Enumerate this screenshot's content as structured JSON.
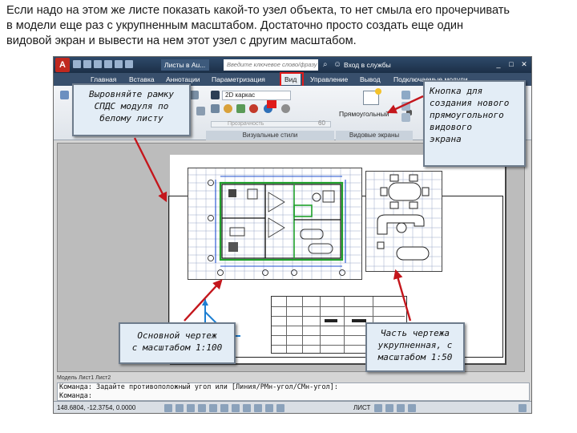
{
  "slide": {
    "lines": [
      "Если надо на этом же листе показать какой-то узел объекта, то нет смыла его прочерчивать",
      "в модели еще раз с укрупненным масштабом. Достаточно просто создать еще один",
      "видовой экран и вывести на нем этот узел с другим масштабом."
    ]
  },
  "titlebar": {
    "logo": "A",
    "doc_tab": "Листы в Au...",
    "search_placeholder": "Введите ключевое слово/фразу",
    "signin": "Вход в службы",
    "buttons": [
      "_",
      "□",
      "✕"
    ]
  },
  "ribbon": {
    "tabs": [
      "Главная",
      "Вставка",
      "Аннотации",
      "Параметризация",
      "Вид",
      "Управление",
      "Вывод",
      "Подключаемые модули"
    ],
    "active_tab": "Вид",
    "visual_style": "2D каркас",
    "transparency_label": "Прозрачность",
    "transparency_value": "60",
    "rect_label": "Прямоугольный",
    "panels": [
      "Визуальные стили",
      "Видовые экраны"
    ]
  },
  "layout_tabs": "Модель  Лист1  Лист2",
  "command": {
    "line1": "Команда: Задайте противоположный угол или [Линия/РМн-угол/СМн-угол]:",
    "line2": "Команда:"
  },
  "status": {
    "coords": "148.6804, -12.3754, 0.0000",
    "mode": "ЛИСТ"
  },
  "callouts": {
    "frame": [
      "Выровняйте рамку",
      "СПДС модуля по",
      "белому листу"
    ],
    "button": [
      "Кнопка для",
      "создания нового",
      "прямоугольного",
      "видового",
      "экрана"
    ],
    "main": [
      "Основной чертеж",
      "с масштабом 1:100"
    ],
    "detail": [
      "Часть чертежа",
      "укрупненная, с",
      "масштабом 1:50"
    ]
  },
  "colors": {
    "accent_red": "#c4161c",
    "callout_fill": "#e3edf6",
    "ribbon_dark": "#384f6c",
    "plan_green": "#1fa12b",
    "plan_blue": "#1d4fcf"
  }
}
